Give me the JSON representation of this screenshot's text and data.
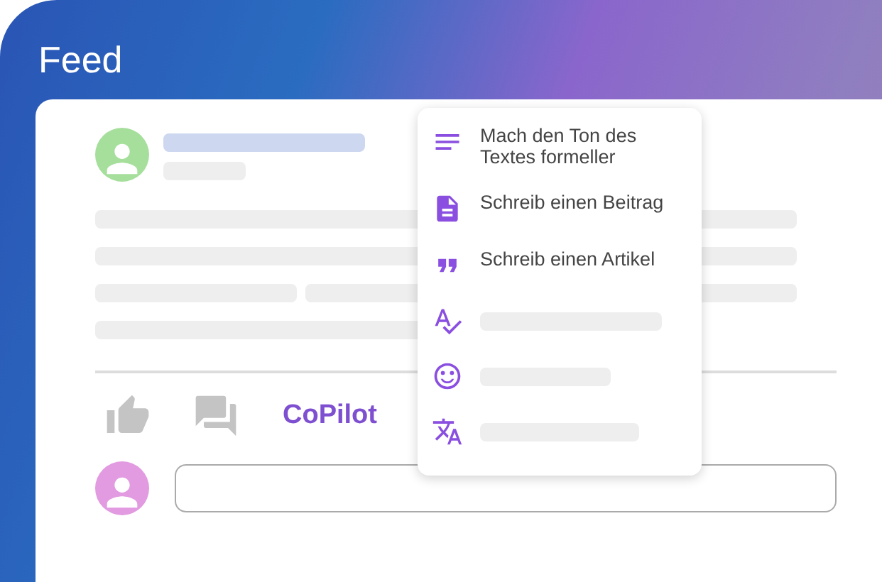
{
  "header": {
    "title": "Feed"
  },
  "actions": {
    "copilot_label": "CoPilot"
  },
  "copilot_menu": {
    "items": [
      {
        "kind": "action",
        "label": "Mach den Ton des Textes formeller"
      },
      {
        "kind": "action",
        "label": "Schreib einen Beitrag"
      },
      {
        "kind": "action",
        "label": "Schreib einen Artikel"
      },
      {
        "kind": "skeleton"
      },
      {
        "kind": "skeleton"
      },
      {
        "kind": "skeleton"
      }
    ]
  }
}
